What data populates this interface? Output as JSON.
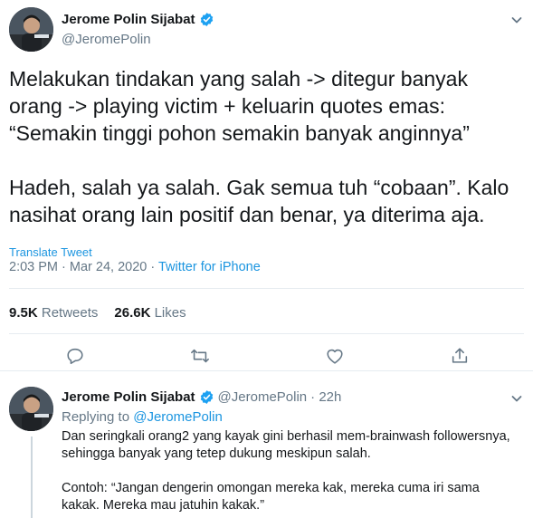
{
  "main_tweet": {
    "author": {
      "display_name": "Jerome Polin Sijabat",
      "handle": "@JeromePolin",
      "verified": true
    },
    "text_lines": [
      "Melakukan tindakan yang salah -> ditegur banyak",
      "orang -> playing victim + keluarin quotes emas:",
      "“Semakin tinggi pohon semakin banyak anginnya”",
      "",
      "Hadeh, salah ya salah. Gak semua tuh “cobaan”. Kalo",
      "nasihat orang lain positif dan benar, ya diterima aja."
    ],
    "translate_label": "Translate Tweet",
    "timestamp": "2:03 PM · Mar 24, 2020 ·",
    "source": "Twitter for iPhone",
    "retweets_count": "9.5K",
    "retweets_label": "Retweets",
    "likes_count": "26.6K",
    "likes_label": "Likes"
  },
  "actions": [
    "reply-icon",
    "retweet-icon",
    "like-icon",
    "share-icon"
  ],
  "reply_tweet": {
    "author": {
      "display_name": "Jerome Polin Sijabat",
      "handle": "@JeromePolin",
      "verified": true
    },
    "time_ago": "· 22h",
    "replying_to_label": "Replying to",
    "replying_to_handle": "@JeromePolin",
    "text_lines": [
      "Dan seringkali orang2 yang kayak gini berhasil mem-brainwash followersnya,",
      "sehingga banyak yang tetep dukung meskipun salah.",
      "",
      "Contoh: “Jangan dengerin omongan mereka kak, mereka cuma iri sama",
      "kakak. Mereka mau jatuhin kakak.”"
    ]
  },
  "colors": {
    "accent": "#1b95e0",
    "verified": "#1da1f2",
    "muted": "#657786",
    "text": "#14171a",
    "divider": "#e6ecf0"
  }
}
